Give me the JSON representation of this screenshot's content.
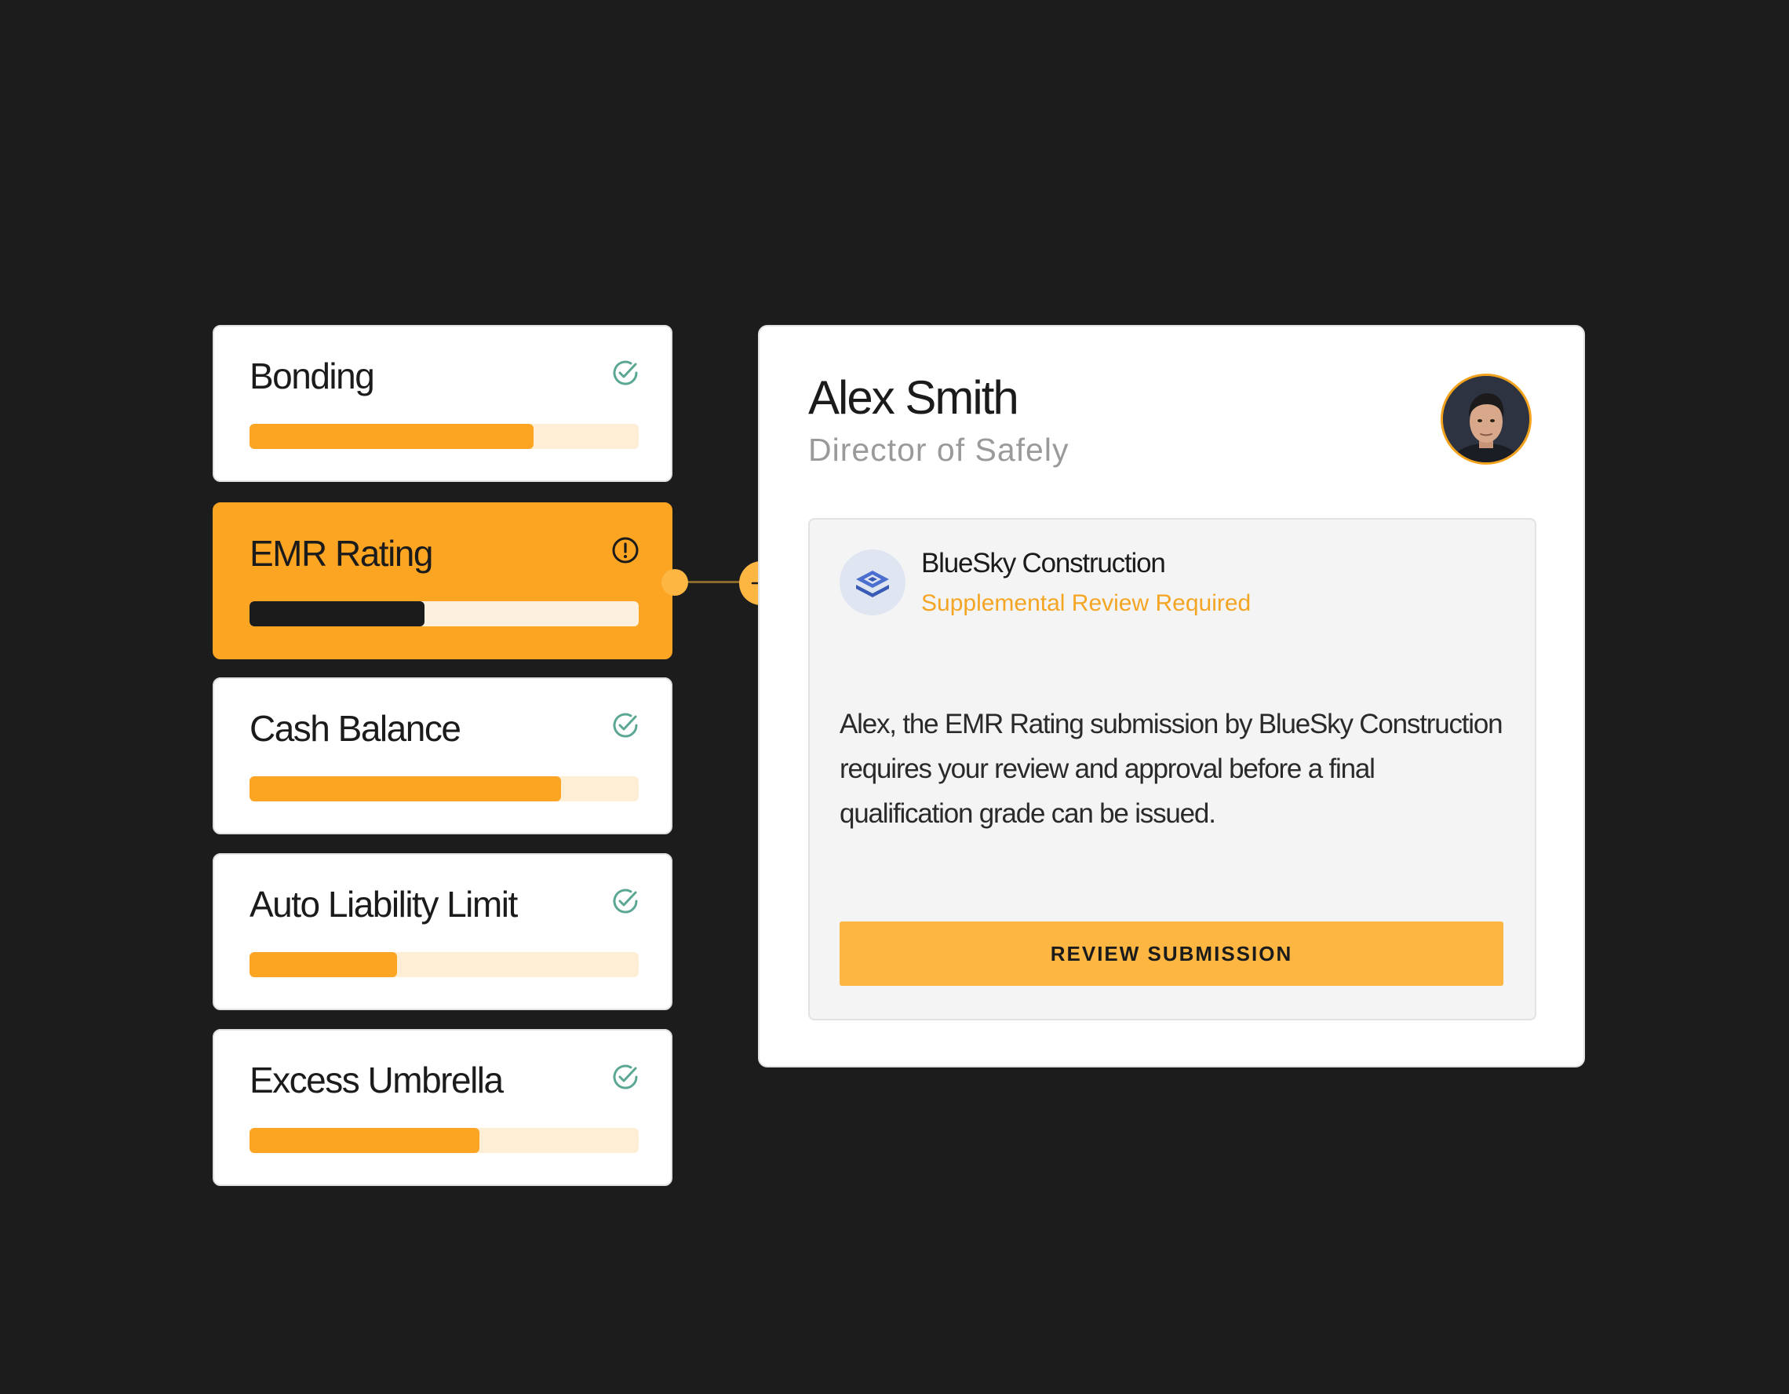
{
  "checklist": {
    "items": [
      {
        "label": "Bonding",
        "icon": "check-circle-icon",
        "status": "complete",
        "progress": 0.73
      },
      {
        "label": "EMR Rating",
        "icon": "alert-circle-icon",
        "status": "alert",
        "progress": 0.45
      },
      {
        "label": "Cash Balance",
        "icon": "check-circle-icon",
        "status": "complete",
        "progress": 0.8
      },
      {
        "label": "Auto Liability Limit",
        "icon": "check-circle-icon",
        "status": "complete",
        "progress": 0.38
      },
      {
        "label": "Excess Umbrella",
        "icon": "check-circle-icon",
        "status": "complete",
        "progress": 0.59
      }
    ]
  },
  "connector": {
    "icon": "plus-icon"
  },
  "profile": {
    "name": "Alex Smith",
    "role": "Director of Safely",
    "avatar_icon": "user-avatar"
  },
  "notification": {
    "company_icon": "company-logo-icon",
    "company_name": "BlueSky Construction",
    "status": "Supplemental Review Required",
    "message": "Alex, the EMR Rating submission by BlueSky Construction requires your review and approval before a final qualification grade can be issued.",
    "button_label": "REVIEW SUBMISSION"
  },
  "colors": {
    "background": "#1c1c1c",
    "accent": "#fca523",
    "accent_light": "#feeed6",
    "success": "#5aa894",
    "button": "#fdb642"
  }
}
